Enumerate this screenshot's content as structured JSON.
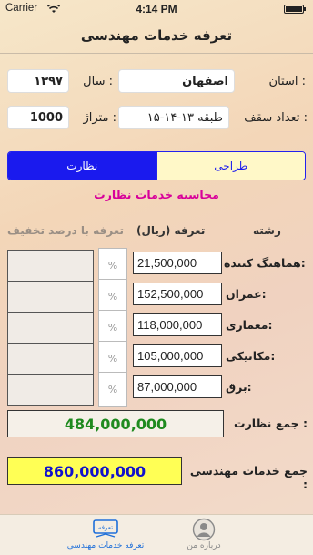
{
  "status_bar": {
    "carrier": "Carrier",
    "time": "4:14 PM"
  },
  "nav": {
    "title": "تعرفه خدمات مهندسی"
  },
  "form": {
    "province_label": "استان :",
    "province_value": "اصفهان",
    "year_label": "سال :",
    "year_value": "۱۳۹۷",
    "floors_label": "تعداد سقف :",
    "floors_value": "۱۵-۱۴-۱۳ طبقه",
    "area_label": "متراژ :",
    "area_value": "1000"
  },
  "segment": {
    "left_label": "نظارت",
    "right_label": "طراحی",
    "selected": "نظارت"
  },
  "section_title": "محاسبه خدمات نظارت",
  "table": {
    "headers": {
      "field": "رشته",
      "tariff": "تعرفه (ریال)",
      "discount": "تعرفه با درصد تخفیف"
    },
    "rows": [
      {
        "label": "هماهنگ کننده:",
        "amount": "21,500,000",
        "pct": "%"
      },
      {
        "label": "عمران:",
        "amount": "152,500,000",
        "pct": "%"
      },
      {
        "label": "معماری:",
        "amount": "118,000,000",
        "pct": "%"
      },
      {
        "label": "مکانیکی:",
        "amount": "105,000,000",
        "pct": "%"
      },
      {
        "label": "برق:",
        "amount": "87,000,000",
        "pct": "%"
      }
    ]
  },
  "totals": {
    "supervision_label": "جمع نظارت :",
    "supervision_value": "484,000,000",
    "engineering_label": "جمع خدمات مهندسی :",
    "engineering_value": "860,000,000"
  },
  "tabbar": {
    "tab_tariff": "تعرفه خدمات مهندسی",
    "tab_tariff_icon_text": "تعرفه",
    "tab_about": "درباره من"
  },
  "colors": {
    "accent_blue": "#1a1aee",
    "section_pink": "#d8009a",
    "total_green": "#1f8a1f",
    "highlight_yellow": "#ffff55"
  }
}
